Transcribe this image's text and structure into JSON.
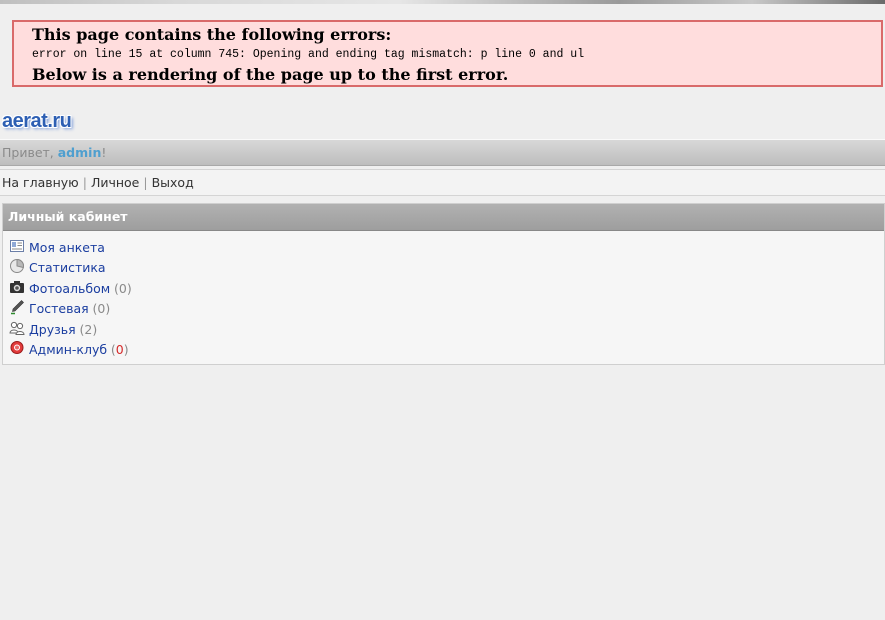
{
  "error": {
    "heading": "This page contains the following errors:",
    "message": "error on line 15 at column 745: Opening and ending tag mismatch: p line 0 and ul",
    "rendering_note": "Below is a rendering of the page up to the first error."
  },
  "logo": {
    "text": "aerat.ru"
  },
  "greeting": {
    "prefix": "Привет, ",
    "username": "admin",
    "suffix": "!"
  },
  "nav": {
    "home": "На главную",
    "personal": "Личное",
    "logout": "Выход",
    "separator": "|"
  },
  "cabinet": {
    "title": "Личный кабинет",
    "items": [
      {
        "label": "Моя анкета",
        "icon": "profile-card-icon"
      },
      {
        "label": "Статистика",
        "icon": "pie-chart-icon"
      },
      {
        "label": "Фотоальбом",
        "icon": "camera-icon",
        "count_open": "(",
        "count": "0",
        "count_close": ")"
      },
      {
        "label": "Гостевая",
        "icon": "pen-icon",
        "count_open": "(",
        "count": "0",
        "count_close": ")"
      },
      {
        "label": "Друзья",
        "icon": "friends-icon",
        "count_open": "(",
        "count": "2",
        "count_close": ")"
      },
      {
        "label": "Админ-клуб",
        "icon": "red-circle-icon",
        "count_open": "(",
        "count": "0",
        "count_close": ")",
        "count_color": "#d42a2a"
      }
    ]
  },
  "colors": {
    "error_bg": "#ffdddd",
    "error_border": "#d96a6a",
    "link": "#1b3ea0",
    "username": "#4f9fcf",
    "panel_header": "#a7a7a7"
  }
}
